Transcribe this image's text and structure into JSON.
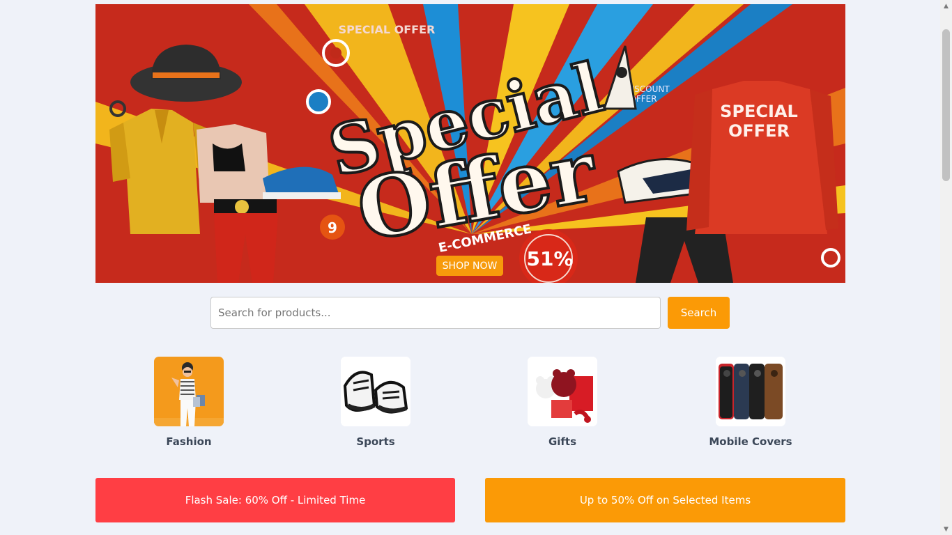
{
  "banner": {
    "headline_line1": "Special",
    "headline_line2": "Offer",
    "tagline": "E-COMMERCE",
    "corner_tag": "SPECIAL OFFER",
    "sweater_text_1": "SPECIAL",
    "sweater_text_2": "OFFER",
    "side_tag_1": "DISCOUNT",
    "side_tag_2": "OFFER",
    "badge_percent": "51%",
    "ball_number": "9",
    "shop_now_label": "SHOP NOW",
    "colors": {
      "background": "#c62a1c",
      "accent": "#f7c11d",
      "button": "#f79a0b"
    }
  },
  "search": {
    "placeholder": "Search for products...",
    "value": "",
    "button_label": "Search"
  },
  "categories": [
    {
      "label": "Fashion"
    },
    {
      "label": "Sports"
    },
    {
      "label": "Gifts"
    },
    {
      "label": "Mobile Covers"
    }
  ],
  "promos": [
    {
      "label": "Flash Sale: 60% Off - Limited Time",
      "color": "#ff3e44"
    },
    {
      "label": "Up to 50% Off on Selected Items",
      "color": "#fb9a06"
    }
  ],
  "icons": [
    "chevron-up-icon",
    "chevron-down-icon"
  ]
}
